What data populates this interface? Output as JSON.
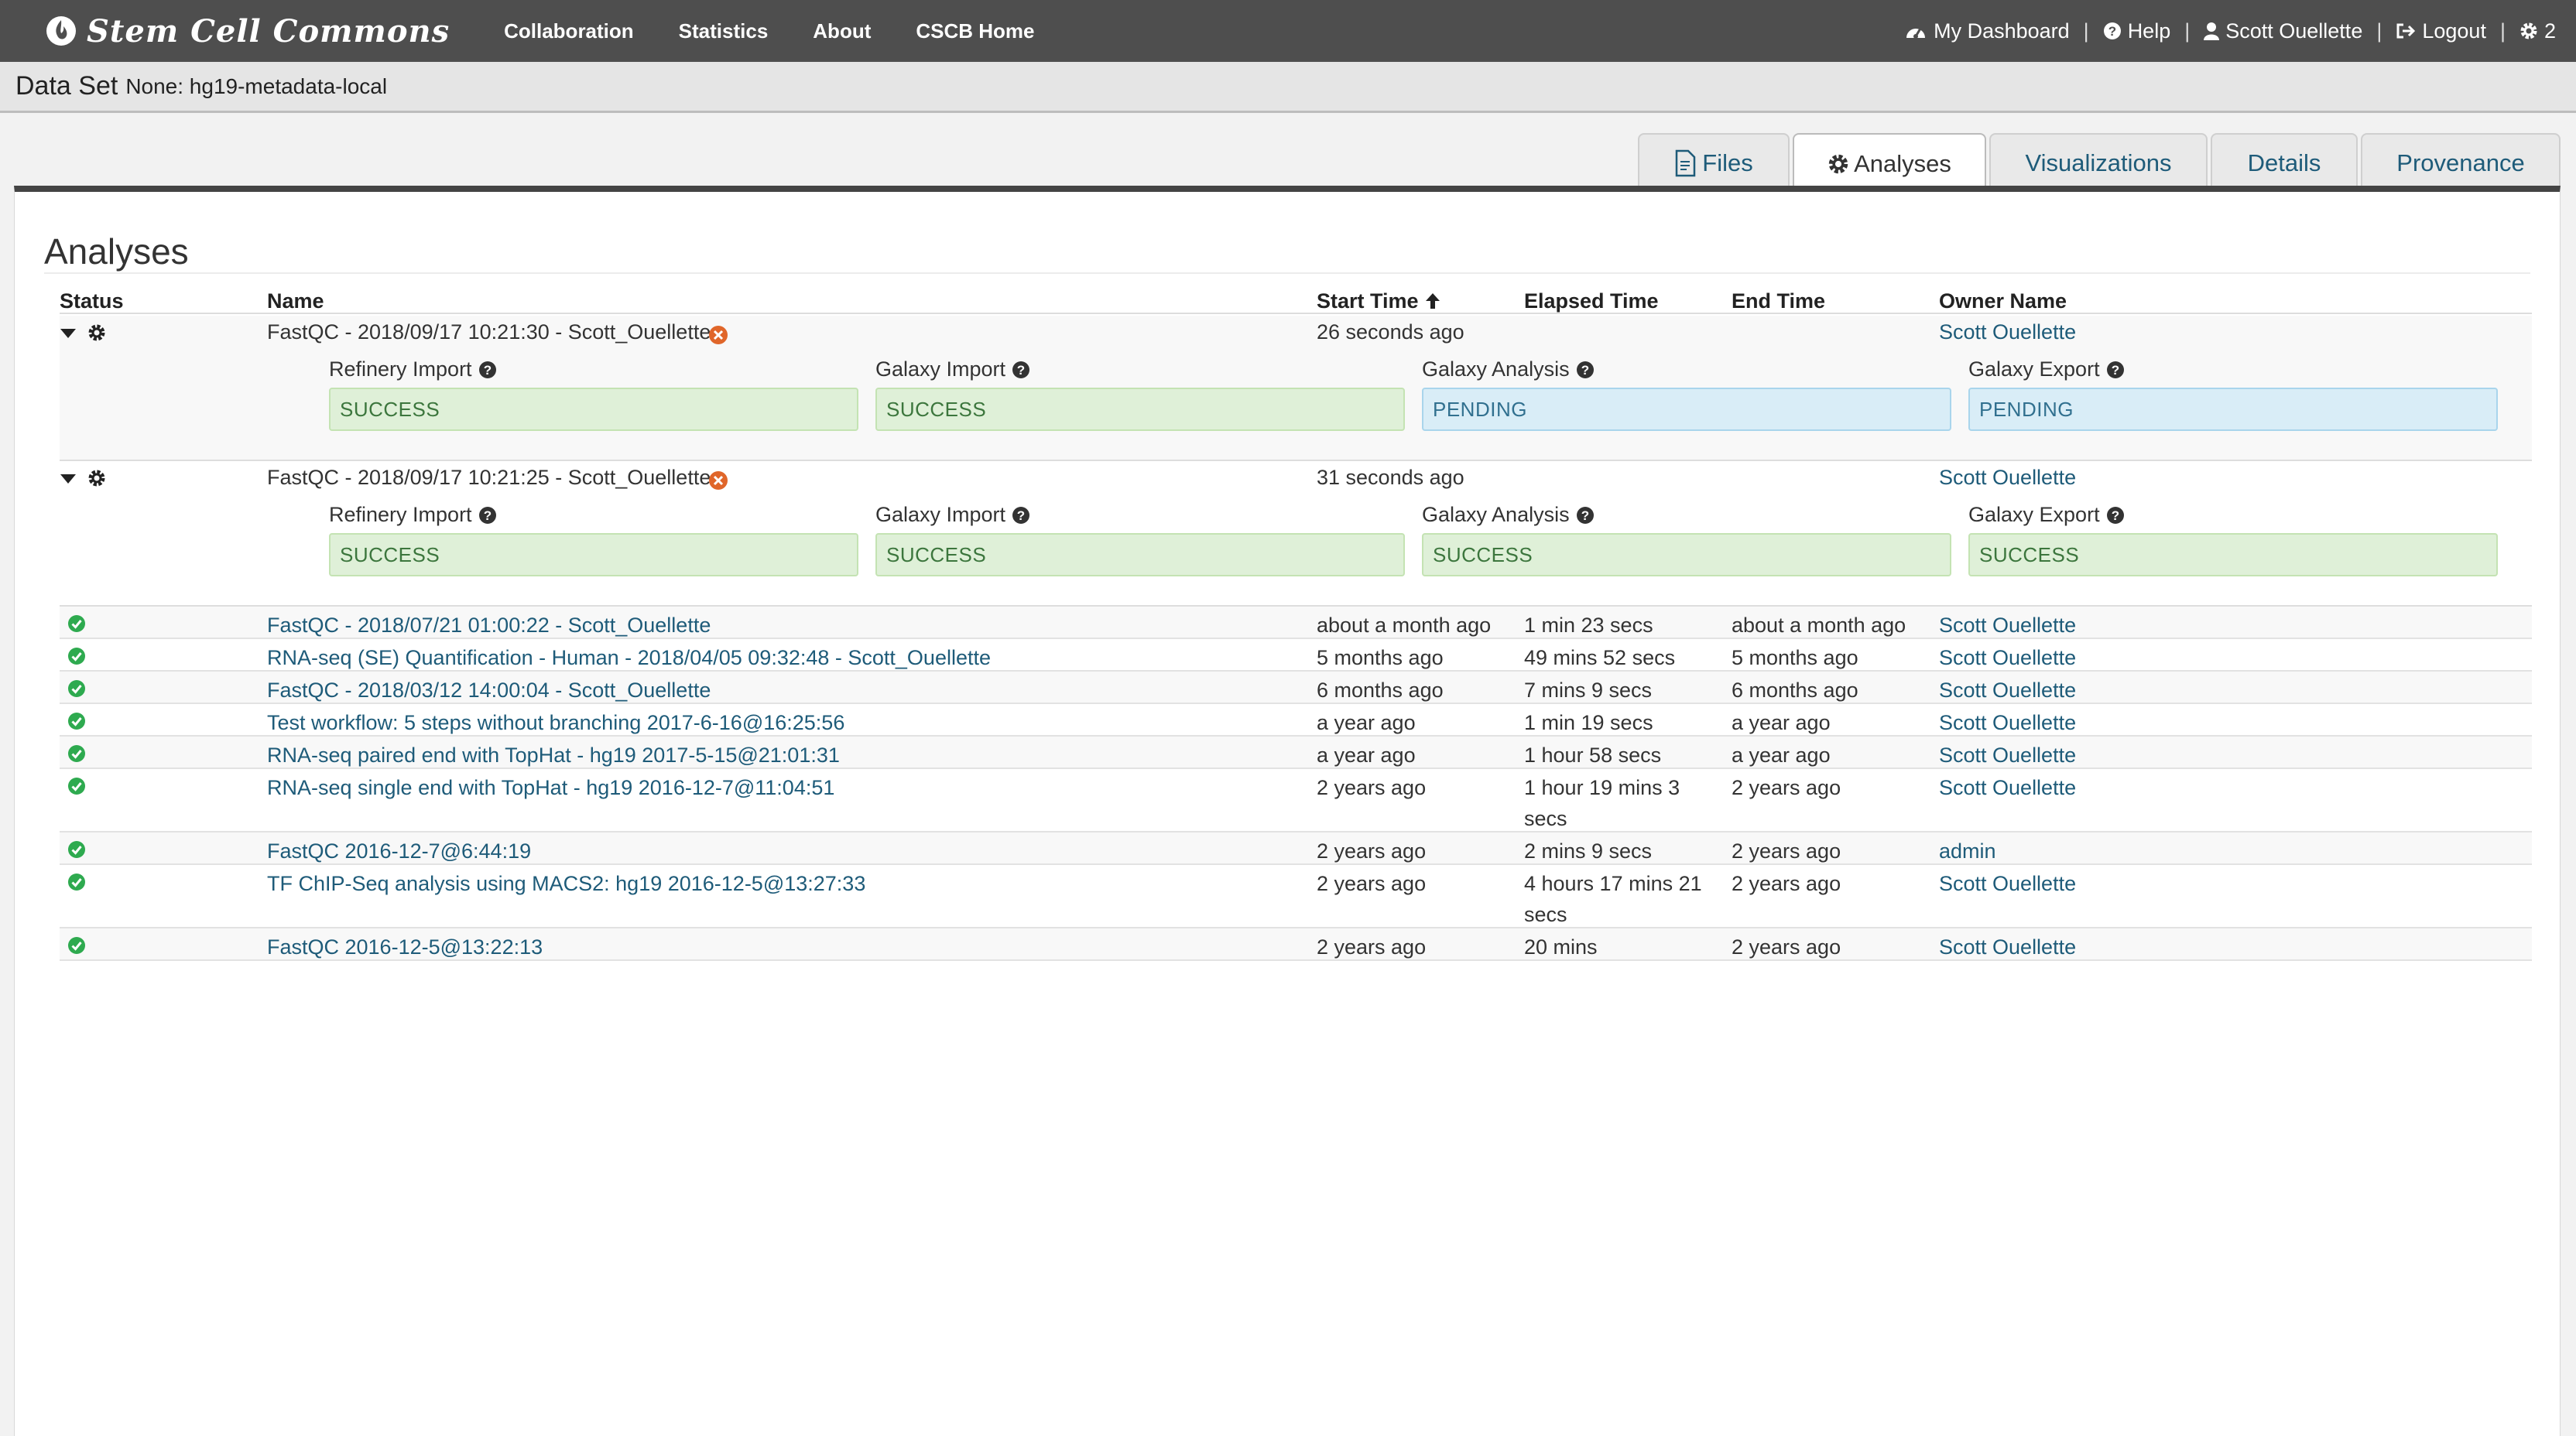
{
  "navbar": {
    "brand": "Stem Cell Commons",
    "links": [
      "Collaboration",
      "Statistics",
      "About",
      "CSCB Home"
    ],
    "dashboard": "My Dashboard",
    "help": "Help",
    "user": "Scott Ouellette",
    "logout": "Logout",
    "notifications": "2"
  },
  "dataset": {
    "label": "Data Set",
    "value": "None: hg19-metadata-local"
  },
  "tabs": [
    "Files",
    "Analyses",
    "Visualizations",
    "Details",
    "Provenance"
  ],
  "page_title": "Analyses",
  "columns": {
    "status": "Status",
    "name": "Name",
    "start": "Start Time",
    "elapsed": "Elapsed Time",
    "end": "End Time",
    "owner": "Owner Name"
  },
  "running": [
    {
      "name": "FastQC - 2018/09/17 10:21:30 - Scott_Ouellette",
      "start": "26 seconds ago",
      "owner": "Scott Ouellette",
      "stages": [
        {
          "title": "Refinery Import",
          "status": "SUCCESS"
        },
        {
          "title": "Galaxy Import",
          "status": "SUCCESS"
        },
        {
          "title": "Galaxy Analysis",
          "status": "PENDING"
        },
        {
          "title": "Galaxy Export",
          "status": "PENDING"
        }
      ]
    },
    {
      "name": "FastQC - 2018/09/17 10:21:25 - Scott_Ouellette",
      "start": "31 seconds ago",
      "owner": "Scott Ouellette",
      "stages": [
        {
          "title": "Refinery Import",
          "status": "SUCCESS"
        },
        {
          "title": "Galaxy Import",
          "status": "SUCCESS"
        },
        {
          "title": "Galaxy Analysis",
          "status": "SUCCESS"
        },
        {
          "title": "Galaxy Export",
          "status": "SUCCESS"
        }
      ]
    }
  ],
  "completed": [
    {
      "name": "FastQC - 2018/07/21 01:00:22 - Scott_Ouellette",
      "start": "about a month ago",
      "elapsed": "1 min 23 secs",
      "elapsed2": "",
      "end": "about a month ago",
      "owner": "Scott Ouellette"
    },
    {
      "name": "RNA-seq (SE) Quantification - Human - 2018/04/05 09:32:48 - Scott_Ouellette",
      "start": "5 months ago",
      "elapsed": "49 mins 52 secs",
      "elapsed2": "",
      "end": "5 months ago",
      "owner": "Scott Ouellette"
    },
    {
      "name": "FastQC - 2018/03/12 14:00:04 - Scott_Ouellette",
      "start": "6 months ago",
      "elapsed": "7 mins 9 secs",
      "elapsed2": "",
      "end": "6 months ago",
      "owner": "Scott Ouellette"
    },
    {
      "name": "Test workflow: 5 steps without branching 2017-6-16@16:25:56",
      "start": "a year ago",
      "elapsed": "1 min 19 secs",
      "elapsed2": "",
      "end": "a year ago",
      "owner": "Scott Ouellette"
    },
    {
      "name": "RNA-seq paired end with TopHat - hg19 2017-5-15@21:01:31",
      "start": "a year ago",
      "elapsed": "1 hour 58 secs",
      "elapsed2": "",
      "end": "a year ago",
      "owner": "Scott Ouellette"
    },
    {
      "name": "RNA-seq single end with TopHat - hg19 2016-12-7@11:04:51",
      "start": "2 years ago",
      "elapsed": "1 hour 19 mins 3",
      "elapsed2": "secs",
      "end": "2 years ago",
      "owner": "Scott Ouellette"
    },
    {
      "name": "FastQC 2016-12-7@6:44:19",
      "start": "2 years ago",
      "elapsed": "2 mins 9 secs",
      "elapsed2": "",
      "end": "2 years ago",
      "owner": "admin"
    },
    {
      "name": "TF ChIP-Seq analysis using MACS2: hg19 2016-12-5@13:27:33",
      "start": "2 years ago",
      "elapsed": "4 hours 17 mins 21",
      "elapsed2": "secs",
      "end": "2 years ago",
      "owner": "Scott Ouellette"
    },
    {
      "name": "FastQC 2016-12-5@13:22:13",
      "start": "2 years ago",
      "elapsed": "20 mins",
      "elapsed2": "",
      "end": "2 years ago",
      "owner": "Scott Ouellette"
    }
  ],
  "colors": {
    "navbar": "#4e4e4e",
    "link": "#1e5b79",
    "success_bg": "#dff0d8",
    "pending_bg": "#d9edf7",
    "ok_icon": "#2eaa4f",
    "cancel_icon": "#e0662a"
  },
  "icons": {
    "brand": "flame-icon",
    "dashboard": "dashboard-icon",
    "help": "question-circle-icon",
    "user": "user-icon",
    "logout": "logout-icon",
    "notifications": "gear-icon",
    "files_tab": "file-icon",
    "analyses_tab": "gear-icon",
    "sort": "arrow-up-icon",
    "expand": "caret-down-icon",
    "running": "gear-icon",
    "cancel": "cancel-circle-icon",
    "stage_help": "question-circle-icon",
    "completed": "check-circle-icon"
  }
}
